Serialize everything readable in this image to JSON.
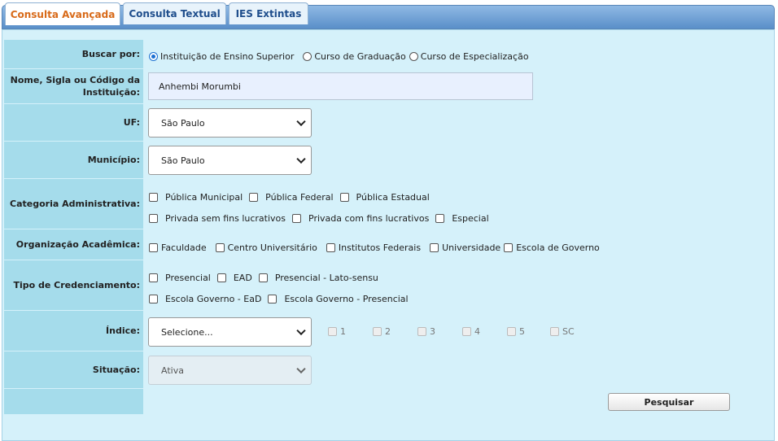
{
  "tabs": [
    {
      "label": "Consulta Avançada",
      "active": true
    },
    {
      "label": "Consulta Textual",
      "active": false
    },
    {
      "label": "IES Extintas",
      "active": false
    }
  ],
  "form": {
    "buscar_por": {
      "label": "Buscar por:",
      "options": [
        "Instituição de Ensino Superior",
        "Curso de Graduação",
        "Curso de Especialização"
      ],
      "selected": 0
    },
    "nome": {
      "label_line1": "Nome, Sigla ou Código da",
      "label_line2": "Instituição:",
      "value": "Anhembi Morumbi"
    },
    "uf": {
      "label": "UF:",
      "value": "São Paulo"
    },
    "municipio": {
      "label": "Município:",
      "value": "São Paulo"
    },
    "categoria": {
      "label": "Categoria Administrativa:",
      "options": [
        "Pública Municipal",
        "Pública Federal",
        "Pública Estadual",
        "Privada sem fins lucrativos",
        "Privada com fins lucrativos",
        "Especial"
      ]
    },
    "organizacao": {
      "label": "Organização Acadêmica:",
      "options": [
        "Faculdade",
        "Centro Universitário",
        "Institutos Federais",
        "Universidade",
        "Escola de Governo"
      ]
    },
    "credenciamento": {
      "label": "Tipo de Credenciamento:",
      "options": [
        "Presencial",
        "EAD",
        "Presencial - Lato-sensu",
        "Escola Governo - EaD",
        "Escola Governo - Presencial"
      ]
    },
    "indice": {
      "label": "Índice:",
      "value": "Selecione...",
      "options": [
        "1",
        "2",
        "3",
        "4",
        "5",
        "SC"
      ]
    },
    "situacao": {
      "label": "Situação:",
      "value": "Ativa"
    },
    "submit_label": "Pesquisar"
  },
  "colors": {
    "panel_bg": "#d5f1fa",
    "label_bg": "#a5dceb",
    "active_tab_text": "#d86a19",
    "tab_text": "#1f4e8c"
  }
}
